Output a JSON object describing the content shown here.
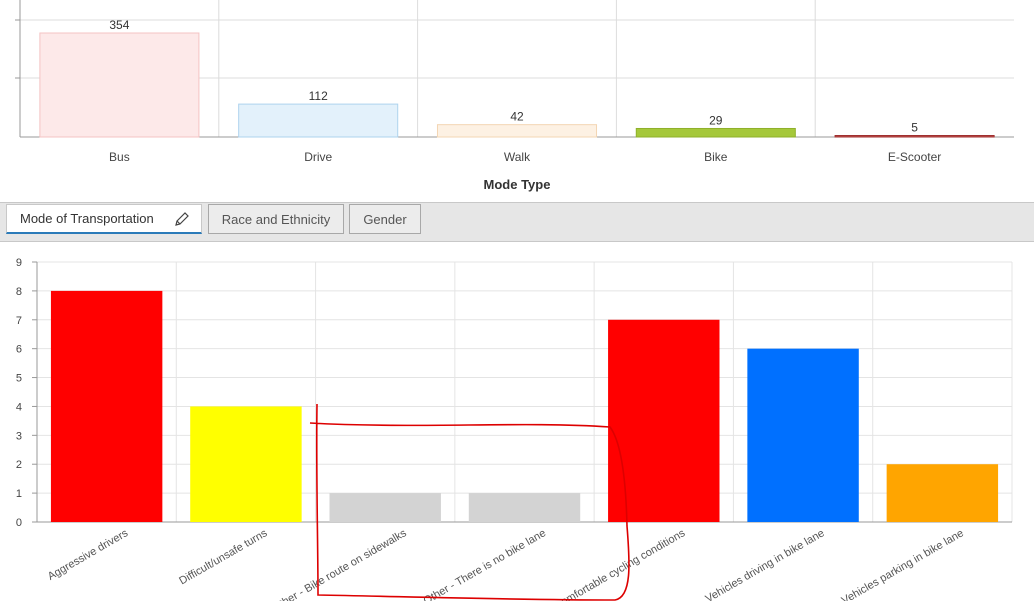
{
  "tabs": [
    {
      "label": "Mode of Transportation",
      "active": true
    },
    {
      "label": "Race and Ethnicity",
      "active": false
    },
    {
      "label": "Gender",
      "active": false
    }
  ],
  "chart_data": [
    {
      "type": "bar",
      "xlabel": "Mode Type",
      "ylabel": "",
      "categories": [
        "Bus",
        "Drive",
        "Walk",
        "Bike",
        "E-Scooter"
      ],
      "values": [
        354,
        112,
        42,
        29,
        5
      ],
      "colors": [
        "#fde9e9",
        "#e3f1fb",
        "#fdf1e3",
        "#a5c83a",
        "#c0504d"
      ],
      "edge_colors": [
        "#f4c3c3",
        "#aed3ee",
        "#f3d6b3",
        "#8fb02a",
        "#a03030"
      ],
      "data_labels": true,
      "grid": true
    },
    {
      "type": "bar",
      "xlabel": "",
      "ylabel": "",
      "categories": [
        "Aggressive drivers",
        "Difficult/unsafe turns",
        "Other - Bike route on sidewalks",
        "Other - There is no bike lane",
        "Uncomfortable cycling conditions",
        "Vehicles driving in bike lane",
        "Vehicles parking in bike lane"
      ],
      "values": [
        8,
        4,
        1,
        1,
        7,
        6,
        2
      ],
      "colors": [
        "#ff0000",
        "#ffff00",
        "#d3d3d3",
        "#d3d3d3",
        "#ff0000",
        "#0070ff",
        "#ffa500"
      ],
      "ylim": [
        0,
        9
      ],
      "yticks": [
        0,
        1,
        2,
        3,
        4,
        5,
        6,
        7,
        8,
        9
      ],
      "grid": true,
      "annotation_color": "#dd0000"
    }
  ]
}
